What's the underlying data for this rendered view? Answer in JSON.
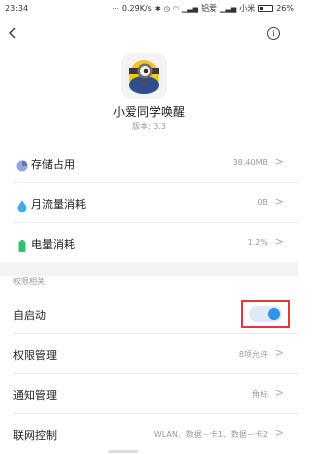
{
  "status_bar": {
    "time": "23:34",
    "speed": "0.29K/s",
    "carrier1": "铝爱",
    "carrier2": "小米",
    "battery": "26%",
    "battery_level": 0.26
  },
  "app": {
    "name": "小爱同学唤醒",
    "version": "版本: 3.3"
  },
  "usage": [
    {
      "label": "存储占用",
      "value": "38.40MB",
      "icon": "storage-pie-icon",
      "color": "#7c8ecf"
    },
    {
      "label": "月流量消耗",
      "value": "0B",
      "icon": "water-drop-icon",
      "color": "#3fa9f0"
    },
    {
      "label": "电量消耗",
      "value": "1.2%",
      "icon": "battery-icon",
      "color": "#33c06a"
    }
  ],
  "permissions": {
    "section_title": "权限相关",
    "autostart_label": "自启动",
    "autostart_on": true,
    "rows": [
      {
        "label": "权限管理",
        "value": "8项允许"
      },
      {
        "label": "通知管理",
        "value": "角标"
      },
      {
        "label": "联网控制",
        "value": "WLAN、数据－卡1、数据－卡2"
      }
    ]
  },
  "colors": {
    "toggle_on": "#2e95e8",
    "highlight": "#e53935"
  }
}
